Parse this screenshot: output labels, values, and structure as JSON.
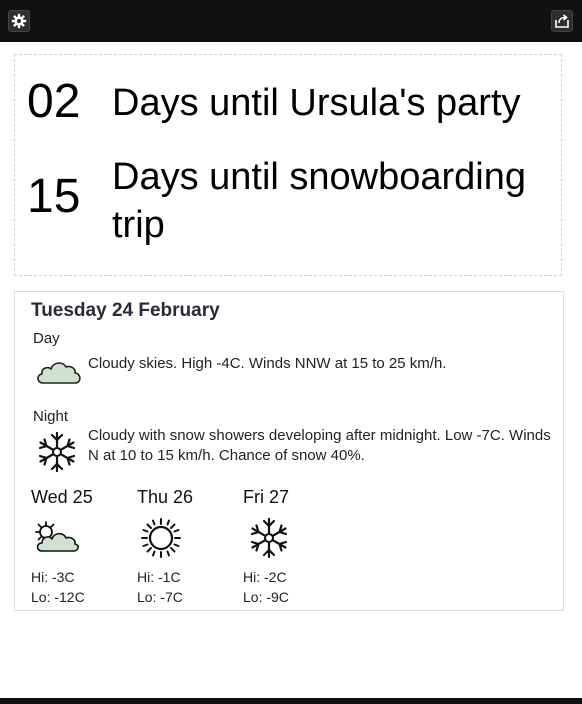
{
  "toolbar": {
    "settings_icon": "gear-icon",
    "share_icon": "share-icon"
  },
  "countdowns": [
    {
      "days": "02",
      "label": "Days until Ursula's party"
    },
    {
      "days": "15",
      "label": "Days until snowboarding trip"
    }
  ],
  "weather": {
    "date": "Tuesday 24 February",
    "day": {
      "label": "Day",
      "icon": "cloud-icon",
      "description": "Cloudy skies. High -4C. Winds NNW at 15 to 25 km/h."
    },
    "night": {
      "label": "Night",
      "icon": "snowflake-icon",
      "description": "Cloudy with snow showers developing after midnight. Low -7C. Winds N at 10 to 15 km/h. Chance of snow 40%."
    },
    "forecast": [
      {
        "day": "Wed 25",
        "icon": "partly-cloudy-icon",
        "hi": "Hi: -3C",
        "lo": "Lo: -12C"
      },
      {
        "day": "Thu 26",
        "icon": "sun-icon",
        "hi": "Hi: -1C",
        "lo": "Lo: -7C"
      },
      {
        "day": "Fri 27",
        "icon": "snowflake-icon",
        "hi": "Hi: -2C",
        "lo": "Lo: -9C"
      }
    ]
  },
  "colors": {
    "topbar": "#111111",
    "cloud_fill": "#cfe2d0",
    "card_border": "#c9d6d3"
  }
}
